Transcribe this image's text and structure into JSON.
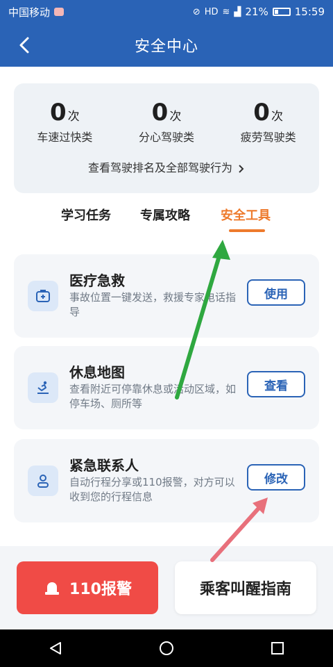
{
  "status_bar": {
    "carrier": "中国移动",
    "battery_percent": "21%",
    "time": "15:59"
  },
  "header": {
    "title": "安全中心"
  },
  "stats": {
    "items": [
      {
        "value": "0",
        "unit": "次",
        "label": "车速过快类"
      },
      {
        "value": "0",
        "unit": "次",
        "label": "分心驾驶类"
      },
      {
        "value": "0",
        "unit": "次",
        "label": "疲劳驾驶类"
      }
    ],
    "link_text": "查看驾驶排名及全部驾驶行为"
  },
  "tabs": {
    "items": [
      "学习任务",
      "专属攻略",
      "安全工具"
    ],
    "active": "安全工具"
  },
  "tools": [
    {
      "title": "医疗急救",
      "desc": "事故位置一键发送，救援专家电话指导",
      "button": "使用",
      "icon": "first-aid-icon"
    },
    {
      "title": "休息地图",
      "desc": "查看附近可停靠休息或活动区域，如停车场、厕所等",
      "button": "查看",
      "icon": "rest-icon"
    },
    {
      "title": "紧急联系人",
      "desc": "自动行程分享或110报警，对方可以收到您的行程信息",
      "button": "修改",
      "icon": "contact-icon"
    }
  ],
  "bottom": {
    "police_label": "110报警",
    "guide_label": "乘客叫醒指南"
  },
  "colors": {
    "primary": "#2a63b6",
    "accent": "#ee7a2c",
    "alert": "#f04b46"
  }
}
